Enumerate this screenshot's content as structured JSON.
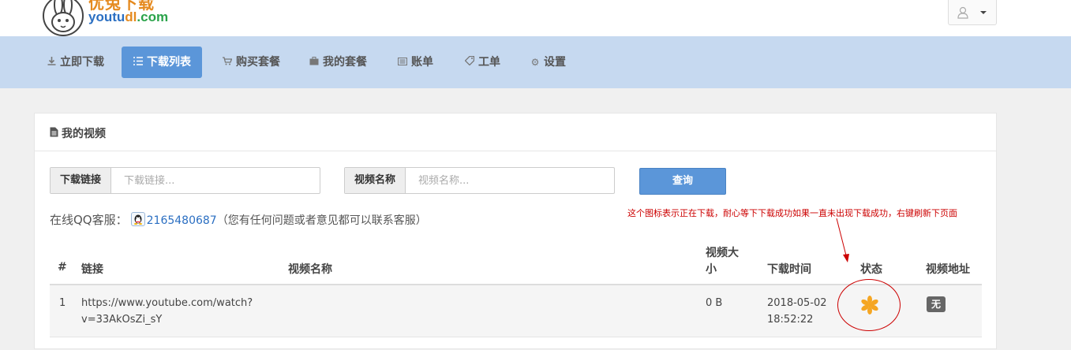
{
  "header": {
    "logo_cn": "优兔下载",
    "logo_en_a": "youtu",
    "logo_en_b": "dl",
    "logo_en_c": ".com"
  },
  "nav": [
    {
      "label": "立即下载",
      "icon": "download-icon"
    },
    {
      "label": "下载列表",
      "icon": "list-icon",
      "active": true
    },
    {
      "label": "购买套餐",
      "icon": "cart-icon"
    },
    {
      "label": "我的套餐",
      "icon": "briefcase-icon"
    },
    {
      "label": "账单",
      "icon": "bill-icon"
    },
    {
      "label": "工单",
      "icon": "tag-icon"
    },
    {
      "label": "设置",
      "icon": "gear-icon"
    }
  ],
  "panel": {
    "title": "我的视频",
    "search": {
      "link_label": "下载链接",
      "link_placeholder": "下载链接...",
      "link_value": "",
      "name_label": "视频名称",
      "name_placeholder": "视频名称...",
      "name_value": "",
      "query_button": "查询"
    },
    "qq": {
      "prefix": "在线QQ客服：",
      "number": "2165480687",
      "note": "（您有任何问题或者意见都可以联系客服）"
    },
    "annotation": "这个图标表示正在下载，耐心等下下载成功如果一直未出现下载成功，右键刷新下页面"
  },
  "table": {
    "headers": [
      "#",
      "链接",
      "视频名称",
      "视频大",
      "小",
      "下载时间",
      "状态",
      "视频地址"
    ],
    "rows": [
      {
        "index": "1",
        "link_line1": "https://www.youtube.com/watch?",
        "link_line2": "v=33AkOsZi_sY",
        "name": "",
        "size": "0 B",
        "date": "2018-05-02",
        "time": "18:52:22",
        "status_icon": "loading-spinner-icon",
        "address_badge": "无"
      }
    ]
  },
  "colors": {
    "navbar_bg": "#c6d9f0",
    "accent": "#5b96d9",
    "annotation": "#cc0000",
    "spinner": "#f5a623"
  }
}
